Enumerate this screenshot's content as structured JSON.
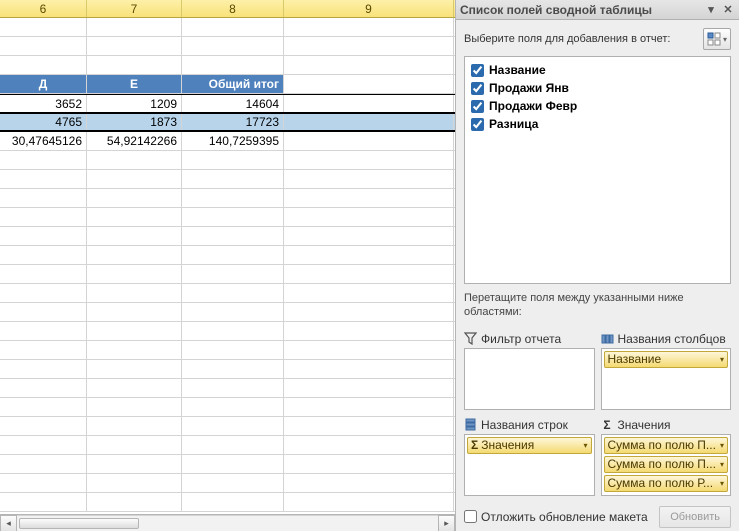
{
  "columns": {
    "c6": "6",
    "c7": "7",
    "c8": "8",
    "c9": "9"
  },
  "pivot": {
    "hdr": {
      "d": "Д",
      "e": "Е",
      "total": "Общий итог"
    },
    "r1": {
      "d": "3652",
      "e": "1209",
      "total": "14604"
    },
    "r2": {
      "d": "4765",
      "e": "1873",
      "total": "17723"
    },
    "r3": {
      "d": "30,47645126",
      "e": "54,92142266",
      "total": "140,7259395"
    }
  },
  "pane": {
    "title": "Список полей сводной таблицы",
    "choose": "Выберите поля для добавления в отчет:",
    "fields": {
      "f0": "Название",
      "f1": "Продажи Янв",
      "f2": "Продажи Февр",
      "f3": "Разница"
    },
    "drag": "Перетащите поля между указанными ниже областями:",
    "area_filter": "Фильтр отчета",
    "area_cols": "Названия столбцов",
    "area_rows": "Названия строк",
    "area_vals": "Значения",
    "pill_name": "Название",
    "pill_sigma": "Значения",
    "pill_v0": "Сумма по полю П...",
    "pill_v1": "Сумма по полю П...",
    "pill_v2": "Сумма по полю Р...",
    "defer": "Отложить обновление макета",
    "update": "Обновить"
  }
}
